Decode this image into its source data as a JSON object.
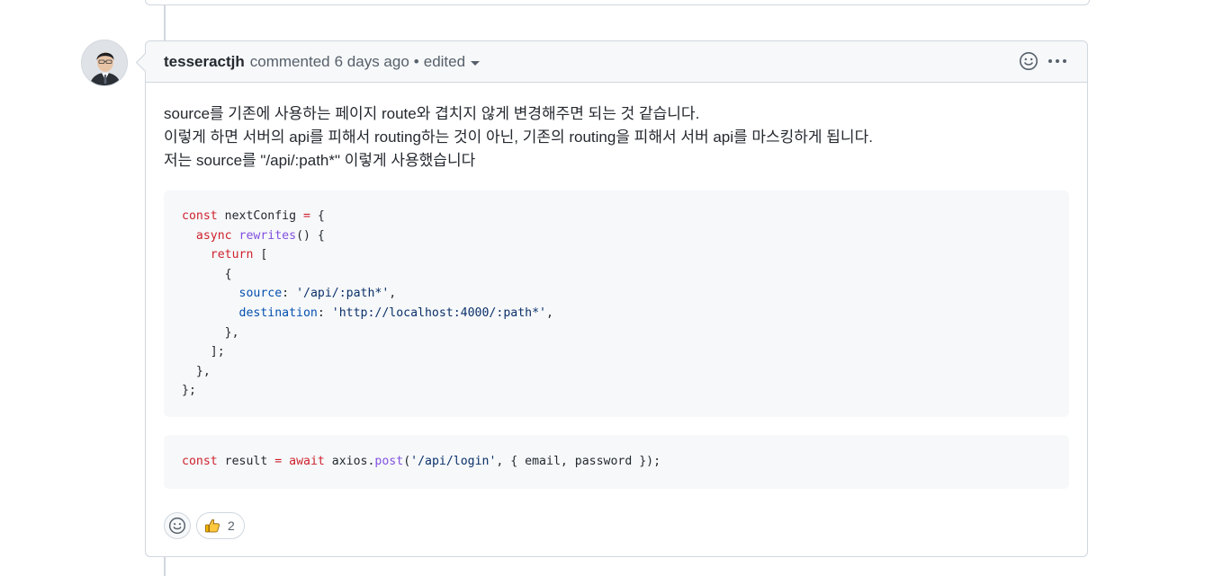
{
  "comment": {
    "author": "tesseractjh",
    "action": "commented",
    "time": "6 days ago",
    "separator": "•",
    "edited_label": "edited",
    "body_lines": [
      "source를 기존에 사용하는 페이지 route와 겹치지 않게 변경해주면 되는 것 같습니다.",
      "이렇게 하면 서버의 api를 피해서 routing하는 것이 아닌, 기존의 routing을 피해서 서버 api를 마스킹하게 됩니다.",
      "저는 source를 \"/api/:path*\" 이렇게 사용했습니다"
    ],
    "code1": {
      "l1_kw": "const",
      "l1_name": " nextConfig ",
      "l1_op": "=",
      "l1_end": " {",
      "l2_kw": "async",
      "l2_fn": "rewrites",
      "l2_end": "() {",
      "l3_kw": "return",
      "l3_end": " [",
      "l4": "{",
      "l5_prop": "source",
      "l5_colon": ": ",
      "l5_str": "'/api/:path*'",
      "l5_end": ",",
      "l6_prop": "destination",
      "l6_colon": ": ",
      "l6_str": "'http://localhost:4000/:path*'",
      "l6_end": ",",
      "l7": "},",
      "l8": "];",
      "l9": "},",
      "l10": "};"
    },
    "code2": {
      "kw1": "const",
      "name": " result ",
      "op": "=",
      "sp": " ",
      "kw2": "await",
      "obj": " axios.",
      "fn": "post",
      "open": "(",
      "str": "'/api/login'",
      "rest": ", { email, password });"
    },
    "reactions": [
      {
        "emoji": "👍",
        "icon": "thumbs-up-icon",
        "count": "2"
      }
    ]
  },
  "colors": {
    "border": "#d0d7de",
    "header_bg": "#f6f8fa",
    "keyword": "#cf222e",
    "function": "#8250df",
    "property": "#0550ae",
    "string": "#0a3069"
  }
}
